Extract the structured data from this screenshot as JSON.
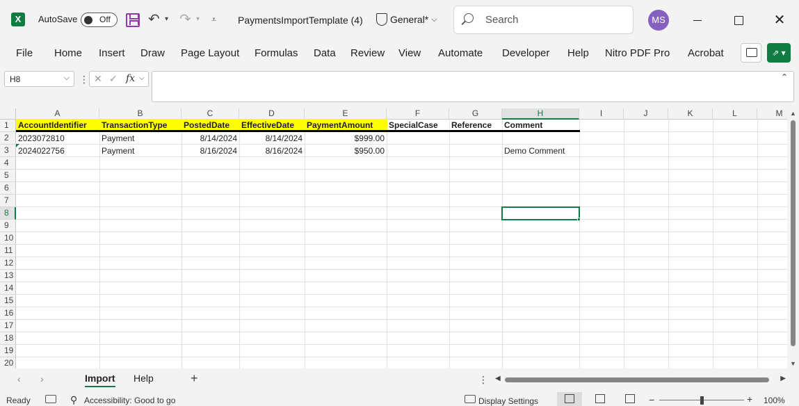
{
  "titlebar": {
    "app_icon_label": "X",
    "autosave_label": "AutoSave",
    "autosave_state": "Off",
    "document_title": "PaymentsImportTemplate (4)",
    "sensitivity_label": "General*",
    "search_placeholder": "Search",
    "avatar_initials": "MS",
    "close_glyph": "✕"
  },
  "ribbon": {
    "tabs": [
      "File",
      "Home",
      "Insert",
      "Draw",
      "Page Layout",
      "Formulas",
      "Data",
      "Review",
      "View",
      "Automate",
      "Developer",
      "Help",
      "Nitro PDF Pro",
      "Acrobat"
    ]
  },
  "formula_bar": {
    "name_box": "H8",
    "fx_label": "fx",
    "formula_value": ""
  },
  "grid": {
    "columns": [
      "A",
      "B",
      "C",
      "D",
      "E",
      "F",
      "G",
      "H",
      "I",
      "J",
      "K",
      "L",
      "M"
    ],
    "selected_column": "H",
    "rows": [
      "1",
      "2",
      "3",
      "4",
      "5",
      "6",
      "7",
      "8",
      "9",
      "10",
      "11",
      "12",
      "13",
      "14",
      "15",
      "16",
      "17",
      "18",
      "19",
      "20"
    ],
    "selected_row": "8",
    "headers": [
      "AccountIdentifier",
      "TransactionType",
      "PostedDate",
      "EffectiveDate",
      "PaymentAmount",
      "SpecialCase",
      "Reference",
      "Comment"
    ],
    "data": [
      [
        "2023072810",
        "Payment",
        "8/14/2024",
        "8/14/2024",
        "$999.00",
        "",
        "",
        ""
      ],
      [
        "2024022756",
        "Payment",
        "8/16/2024",
        "8/16/2024",
        "$950.00",
        "",
        "",
        "Demo Comment"
      ]
    ],
    "highlight_color": "#ffff00",
    "accent_color": "#107c41"
  },
  "sheets": {
    "tabs": [
      "Import",
      "Help"
    ],
    "active": "Import"
  },
  "statusbar": {
    "ready": "Ready",
    "accessibility": "Accessibility: Good to go",
    "display_settings": "Display Settings",
    "zoom": "100%"
  }
}
